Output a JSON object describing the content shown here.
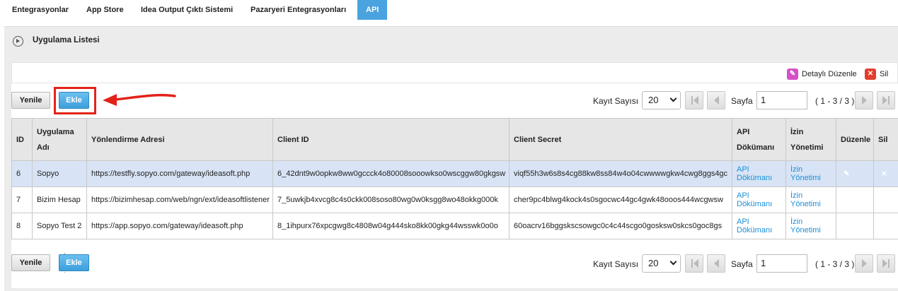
{
  "topnav": {
    "tabs": [
      {
        "label": "Entegrasyonlar"
      },
      {
        "label": "App Store"
      },
      {
        "label": "Idea Output Çıktı Sistemi"
      },
      {
        "label": "Pazaryeri Entegrasyonları"
      },
      {
        "label": "API",
        "active": true
      }
    ]
  },
  "panel": {
    "title": "Uygulama Listesi"
  },
  "actions": {
    "edit_label": "Detaylı Düzenle",
    "delete_label": "Sil"
  },
  "toolbar": {
    "refresh_label": "Yenile",
    "add_label": "Ekle",
    "record_count_label": "Kayıt Sayısı",
    "record_count_value": "20",
    "page_label": "Sayfa",
    "page_value": "1",
    "range_text": "( 1 - 3 / 3 )"
  },
  "table": {
    "headers": {
      "id": "ID",
      "app_name": "Uygulama Adı",
      "redirect": "Yönlendirme Adresi",
      "client_id": "Client ID",
      "client_secret": "Client Secret",
      "api_doc": "API Dökümanı",
      "permission": "İzin Yönetimi",
      "edit": "Düzenle",
      "delete": "Sil"
    },
    "rows": [
      {
        "id": "6",
        "name": "Sopyo",
        "redirect": "https://testfly.sopyo.com/gateway/ideasoft.php",
        "client_id": "6_42dnt9w0opkw8ww0gccck4o80008sooowkso0wscggw80gkgsw",
        "client_secret": "viqf55h3w6s8s4cg88kw8ss84w4o04cwwwwgkw4cwg8ggs4gc",
        "api_doc": "API Dökümanı",
        "permission": "İzin Yönetimi"
      },
      {
        "id": "7",
        "name": "Bizim Hesap",
        "redirect": "https://bizimhesap.com/web/ngn/ext/ideasoftlistener",
        "client_id": "7_5uwkjb4xvcg8c4s0ckk008soso80wg0w0ksgg8wo48okkg000k",
        "client_secret": "cher9pc4blwg4kock4s0sgocwc44gc4gwk48ooos444wcgwsw",
        "api_doc": "API Dökümanı",
        "permission": "İzin Yönetimi"
      },
      {
        "id": "8",
        "name": "Sopyo Test 2",
        "redirect": "https://app.sopyo.com/gateway/ideasoft.php",
        "client_id": "8_1ihpurx76xpcgwg8c4808w04g444sko8kk00gkg44wsswk0o0o",
        "client_secret": "60oacrv16bggskscsowgc0c4c44scgo0gosksw0skcs0goc8gs",
        "api_doc": "API Dökümanı",
        "permission": "İzin Yönetimi"
      }
    ]
  },
  "colors": {
    "accent": "#4aa3df",
    "highlight": "#e32219",
    "edit_icon": "#d54fc8",
    "delete_icon": "#e23d2d",
    "selected_row": "#d8e4f5"
  },
  "icons": {
    "panel_toggle": "play-circle-icon",
    "edit": "edit-icon",
    "delete": "close-icon",
    "first": "first-page-icon",
    "prev": "prev-page-icon",
    "next": "next-page-icon",
    "last": "last-page-icon"
  }
}
